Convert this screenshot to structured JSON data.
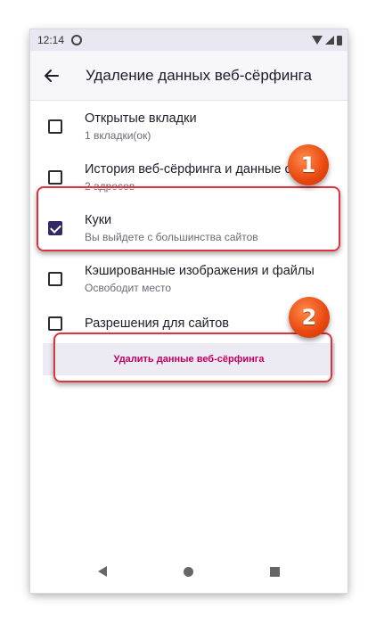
{
  "status_bar": {
    "time": "12:14"
  },
  "toolbar": {
    "title": "Удаление данных веб-сёрфинга"
  },
  "items": [
    {
      "title": "Открытые вкладки",
      "subtitle": "1 вкладки(ок)",
      "checked": false
    },
    {
      "title": "История веб-сёрфинга и данные сайтов",
      "subtitle": "2 адресов",
      "checked": false
    },
    {
      "title": "Куки",
      "subtitle": "Вы выйдете с большинства сайтов",
      "checked": true
    },
    {
      "title": "Кэшированные изображения и файлы",
      "subtitle": "Освободит место",
      "checked": false
    },
    {
      "title": "Разрешения для сайтов",
      "subtitle": "",
      "checked": false
    }
  ],
  "delete_button": {
    "label": "Удалить данные веб-сёрфинга"
  },
  "annotations": {
    "badge1": "1",
    "badge2": "2",
    "color": "#e0323c"
  }
}
